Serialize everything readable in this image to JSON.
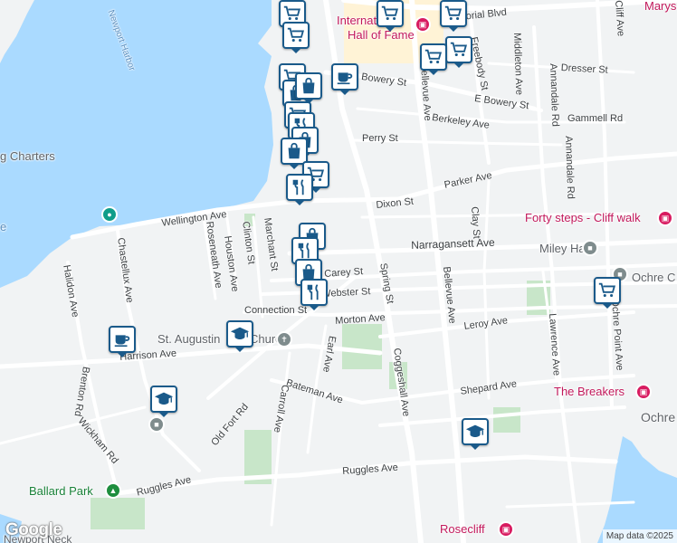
{
  "map": {
    "attribution": "Map data ©2025",
    "logo": "Google",
    "colors": {
      "water": "#aadaff",
      "land": "#f1f3f4",
      "park": "#c8e6c9",
      "road": "#ffffff",
      "marker_border": "#1a5a8a",
      "poi": "#c2185b"
    }
  },
  "streets": [
    "Memorial Blvd",
    "Bowery St",
    "E Bowery St",
    "Dresser St",
    "Gammell Rd",
    "Berkeley Ave",
    "Perry St",
    "Parker Ave",
    "Dixon St",
    "Wellington Ave",
    "Narragansett Ave",
    "Carey St",
    "Webster St",
    "Connection St",
    "Morton Ave",
    "Leroy Ave",
    "Halidon Ave",
    "Harrison Ave",
    "Bateman Ave",
    "Shepard Ave",
    "Ruggles Ave",
    "Spring St",
    "Coggeshall Ave",
    "Bellevue Ave",
    "Freebody St",
    "Middleton Ave",
    "Annandale Rd",
    "Clay St",
    "Lawrence Ave",
    "Ochre Point Ave",
    "Cliff Ave",
    "Chastellux Ave",
    "Roseneath Ave",
    "Clinton St",
    "Houston Ave",
    "Marchant St",
    "Earl Ave",
    "Carroll Ave",
    "Old Fort Rd",
    "Brenton Rd",
    "Wickham Rd",
    "Halidon Ave"
  ],
  "pois": {
    "forty_steps": "Forty steps - Cliff walk",
    "miley_hall": "Miley Hall",
    "the_breakers": "The Breakers",
    "rosecliff": "Rosecliff",
    "st_augustin": "St. Augustin",
    "church_suffix": "Church",
    "ballard_park": "Ballard Park",
    "charters": "g Charters",
    "international": "International",
    "hall_of_fame": "Hall of Fame",
    "ochre_c": "Ochre C",
    "ochre_right": "Ochre",
    "marys": "Marys",
    "newport_harbor": "Newport Harbor",
    "newport_neck": "Newport Neck",
    "water_e": "e"
  },
  "markers": {
    "types": [
      "shopping-cart",
      "coffee-cup",
      "shopping-bag",
      "restaurant",
      "graduation-cap"
    ]
  }
}
